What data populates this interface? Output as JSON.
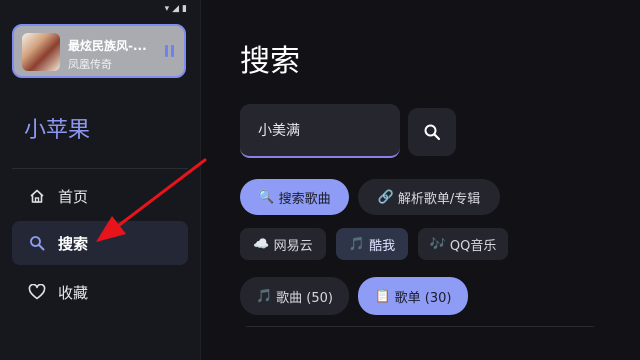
{
  "status_bar": {
    "icons": "▾◢▮"
  },
  "now_playing": {
    "title": "最炫民族风-...",
    "artist": "凤凰传奇"
  },
  "sidebar": {
    "brand": "小苹果",
    "items": [
      {
        "label": "首页",
        "icon": "home-icon"
      },
      {
        "label": "搜索",
        "icon": "search-icon",
        "active": true
      },
      {
        "label": "收藏",
        "icon": "heart-icon"
      }
    ]
  },
  "main": {
    "title": "搜索",
    "search": {
      "value": "小美满"
    },
    "mode_chips": [
      {
        "emoji": "🔍",
        "label": "搜索歌曲"
      },
      {
        "emoji": "🔗",
        "label": "解析歌单/专辑"
      }
    ],
    "source_chips": [
      {
        "emoji": "☁️",
        "label": "网易云"
      },
      {
        "emoji": "🎵",
        "label": "酷我"
      },
      {
        "emoji": "🎶",
        "label": "QQ音乐"
      }
    ],
    "result_tabs": [
      {
        "emoji": "🎵",
        "label": "歌曲 (50)"
      },
      {
        "emoji": "📋",
        "label": "歌单 (30)"
      }
    ]
  },
  "colors": {
    "accent": "#8e9cf6",
    "annotation_arrow": "#e8141c"
  }
}
